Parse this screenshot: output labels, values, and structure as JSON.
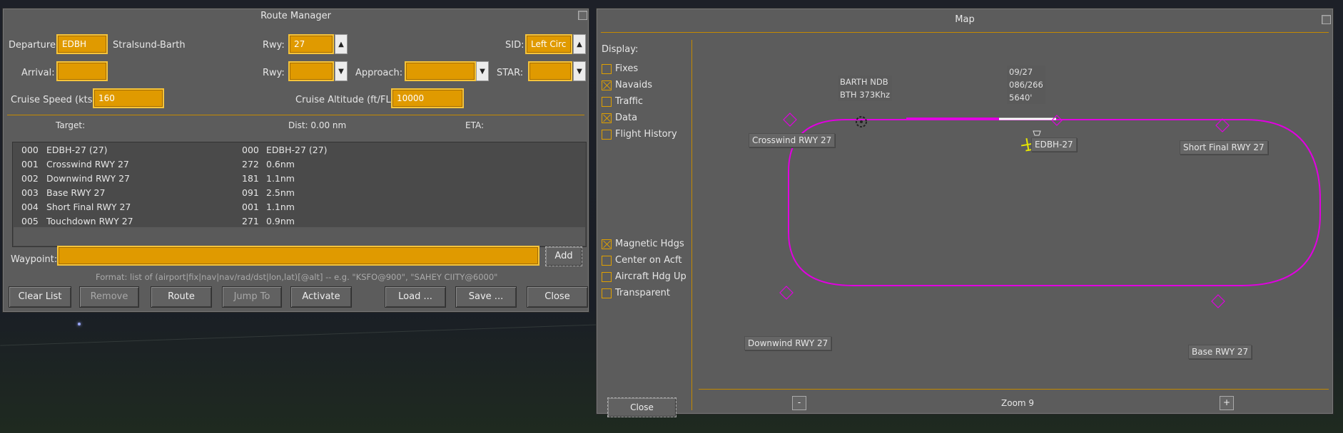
{
  "route_manager": {
    "title": "Route Manager",
    "departure": {
      "label": "Departure:",
      "value": "EDBH",
      "name": "Stralsund-Barth"
    },
    "dep_rwy": {
      "label": "Rwy:",
      "value": "27"
    },
    "sid": {
      "label": "SID:",
      "value": "Left Circ"
    },
    "arrival": {
      "label": "Arrival:",
      "value": ""
    },
    "arr_rwy": {
      "label": "Rwy:",
      "value": ""
    },
    "approach": {
      "label": "Approach:",
      "value": ""
    },
    "star": {
      "label": "STAR:",
      "value": ""
    },
    "cruise_speed": {
      "label": "Cruise Speed (kts):",
      "value": "160"
    },
    "cruise_alt": {
      "label": "Cruise Altitude (ft/FL):",
      "value": "10000"
    },
    "list_header": {
      "target": "Target:",
      "dist": "Dist: 0.00 nm",
      "eta": "ETA:"
    },
    "rows": [
      {
        "idx": "000",
        "name": "EDBH-27 (27)",
        "hdg": "000",
        "info": "EDBH-27 (27)"
      },
      {
        "idx": "001",
        "name": "Crosswind RWY 27",
        "hdg": "272",
        "info": "0.6nm"
      },
      {
        "idx": "002",
        "name": "Downwind RWY 27",
        "hdg": "181",
        "info": "1.1nm"
      },
      {
        "idx": "003",
        "name": "Base RWY 27",
        "hdg": "091",
        "info": "2.5nm"
      },
      {
        "idx": "004",
        "name": "Short Final RWY 27",
        "hdg": "001",
        "info": "1.1nm"
      },
      {
        "idx": "005",
        "name": "Touchdown RWY 27",
        "hdg": "271",
        "info": "0.9nm"
      }
    ],
    "waypoint": {
      "label": "Waypoint:",
      "value": "",
      "add": "Add"
    },
    "format_hint": "Format: list of (airport|fix|nav|nav/rad/dst|lon,lat)[@alt] -- e.g. \"KSFO@900\", \"SAHEY CIITY@6000\"",
    "buttons": {
      "clear_list": "Clear List",
      "remove": "Remove",
      "route": "Route",
      "jump_to": "Jump To",
      "activate": "Activate",
      "load": "Load ...",
      "save": "Save ...",
      "close": "Close"
    }
  },
  "map": {
    "title": "Map",
    "display_label": "Display:",
    "toggles": [
      {
        "label": "Fixes",
        "checked": false
      },
      {
        "label": "Navaids",
        "checked": true
      },
      {
        "label": "Traffic",
        "checked": false
      },
      {
        "label": "Data",
        "checked": true
      },
      {
        "label": "Flight History",
        "checked": false
      }
    ],
    "options": [
      {
        "label": "Magnetic Hdgs",
        "checked": true
      },
      {
        "label": "Center on Acft",
        "checked": false
      },
      {
        "label": "Aircraft Hdg Up",
        "checked": false
      },
      {
        "label": "Transparent",
        "checked": false
      }
    ],
    "close": "Close",
    "zoom_minus": "-",
    "zoom_label": "Zoom 9",
    "zoom_plus": "+",
    "ndb": {
      "name": "BARTH NDB",
      "ident": "BTH 373Khz"
    },
    "runway_info": {
      "rwy": "09/27",
      "hdg": "086/266",
      "len": "5640'"
    },
    "waypoints": {
      "crosswind": "Crosswind RWY 27",
      "short_final": "Short Final RWY 27",
      "downwind": "Downwind RWY 27",
      "base": "Base RWY 27",
      "airport": "EDBH-27"
    },
    "colors": {
      "route": "#e000e0",
      "accent": "#e09a00",
      "aircraft": "#e8e800"
    }
  }
}
